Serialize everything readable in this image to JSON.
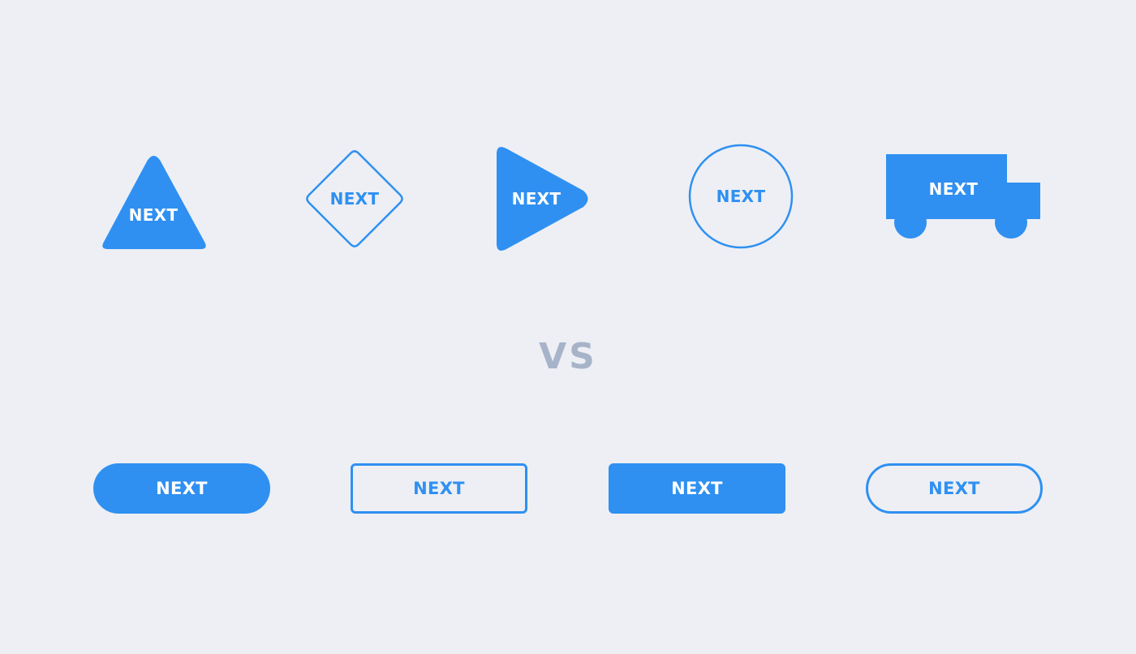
{
  "colors": {
    "background": "#edeff4",
    "accent": "#2f90f1",
    "vs_text": "#a6b3c9",
    "on_accent_text": "#ffffff"
  },
  "shape_buttons": [
    {
      "shape": "triangle",
      "style": "filled",
      "label": "NEXT"
    },
    {
      "shape": "diamond",
      "style": "outline",
      "label": "NEXT"
    },
    {
      "shape": "play-arrow",
      "style": "filled",
      "label": "NEXT"
    },
    {
      "shape": "circle",
      "style": "outline",
      "label": "NEXT"
    },
    {
      "shape": "truck",
      "style": "filled",
      "label": "NEXT"
    }
  ],
  "divider_text": "VS",
  "standard_buttons": [
    {
      "shape": "pill",
      "style": "filled",
      "label": "NEXT"
    },
    {
      "shape": "rectangle",
      "style": "outline",
      "label": "NEXT"
    },
    {
      "shape": "rectangle",
      "style": "filled",
      "label": "NEXT"
    },
    {
      "shape": "pill",
      "style": "outline",
      "label": "NEXT"
    }
  ]
}
